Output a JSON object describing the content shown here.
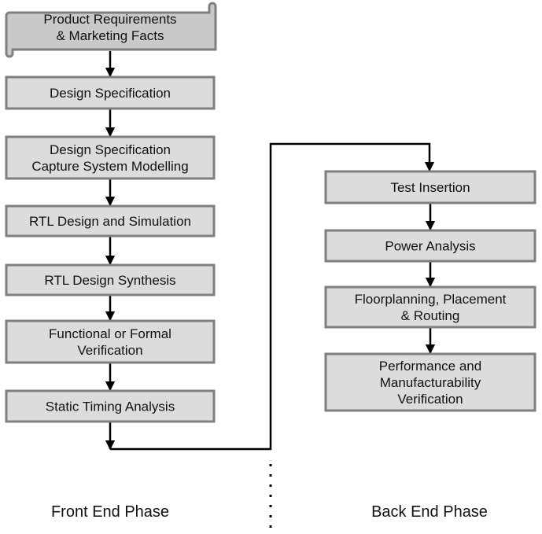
{
  "front_end": {
    "phase_label": "Front End Phase",
    "steps": [
      {
        "lines": [
          "Product Requirements",
          "& Marketing Facts"
        ]
      },
      {
        "lines": [
          "Design Specification"
        ]
      },
      {
        "lines": [
          "Design Specification",
          "Capture System Modelling"
        ]
      },
      {
        "lines": [
          "RTL Design and Simulation"
        ]
      },
      {
        "lines": [
          "RTL Design Synthesis"
        ]
      },
      {
        "lines": [
          "Functional or Formal",
          "Verification"
        ]
      },
      {
        "lines": [
          "Static Timing Analysis"
        ]
      }
    ]
  },
  "back_end": {
    "phase_label": "Back End Phase",
    "steps": [
      {
        "lines": [
          "Test Insertion"
        ]
      },
      {
        "lines": [
          "Power Analysis"
        ]
      },
      {
        "lines": [
          "Floorplanning, Placement",
          "& Routing"
        ]
      },
      {
        "lines": [
          "Performance and",
          "Manufacturability",
          "Verification"
        ]
      }
    ]
  },
  "colors": {
    "box_fill": "#dcdcdc",
    "first_box_fill": "#c9c9c9",
    "box_border": "#7f7f7f"
  }
}
